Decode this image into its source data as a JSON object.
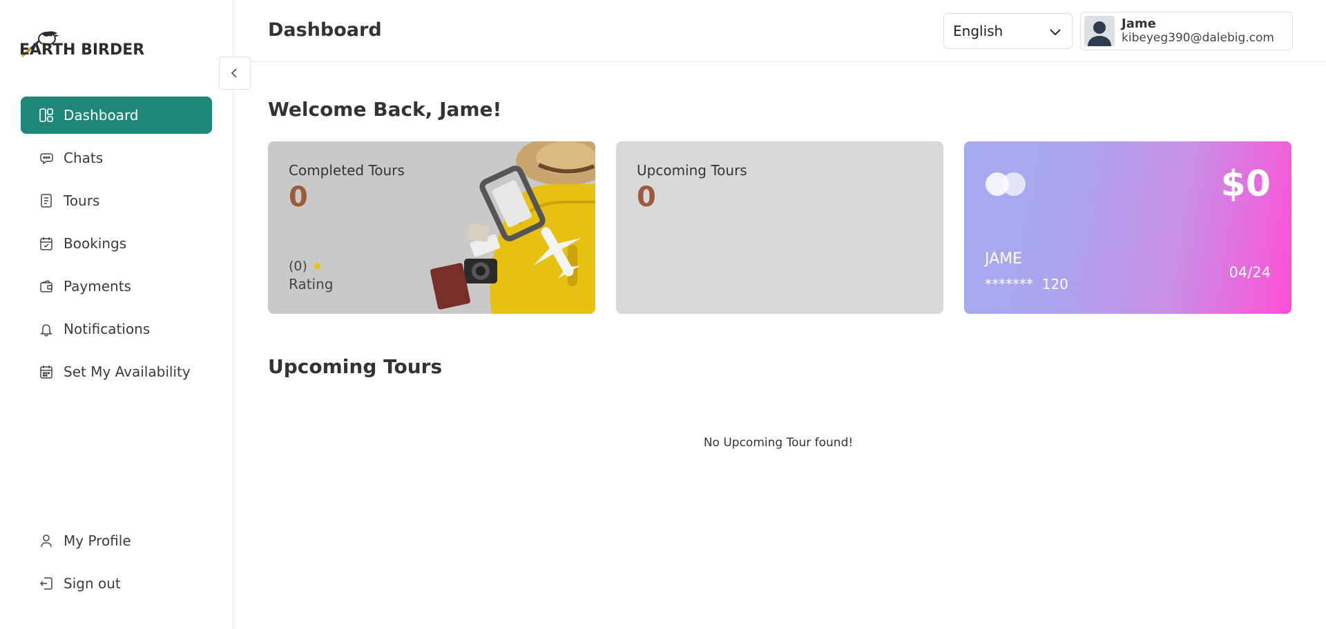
{
  "brand": {
    "name": "EARTH BIRDER"
  },
  "sidebar": {
    "items": [
      {
        "label": "Dashboard",
        "icon": "dashboard-icon",
        "active": true
      },
      {
        "label": "Chats",
        "icon": "chat-icon"
      },
      {
        "label": "Tours",
        "icon": "document-icon"
      },
      {
        "label": "Bookings",
        "icon": "calendar-check-icon"
      },
      {
        "label": "Payments",
        "icon": "wallet-icon"
      },
      {
        "label": "Notifications",
        "icon": "bell-icon"
      },
      {
        "label": "Set My Availability",
        "icon": "calendar-icon"
      }
    ],
    "bottom_items": [
      {
        "label": "My Profile",
        "icon": "user-icon"
      },
      {
        "label": "Sign out",
        "icon": "sign-out-icon"
      }
    ]
  },
  "header": {
    "title": "Dashboard",
    "language": "English",
    "user": {
      "name": "Jame",
      "email": "kibeyeg390@dalebig.com"
    }
  },
  "main": {
    "welcome": "Welcome Back, Jame!",
    "completed": {
      "label": "Completed Tours",
      "count": "0",
      "rating_count": "(0)",
      "rating_label": "Rating"
    },
    "upcoming": {
      "label": "Upcoming Tours",
      "count": "0"
    },
    "payment_card": {
      "amount": "$0",
      "name": "JAME",
      "masked": "*******",
      "last_digits": "120",
      "expiry": "04/24"
    },
    "section_title": "Upcoming Tours",
    "empty_message": "No Upcoming Tour found!"
  },
  "colors": {
    "accent": "#1f877a",
    "count": "#9c5a3e",
    "star": "#f2c200"
  }
}
